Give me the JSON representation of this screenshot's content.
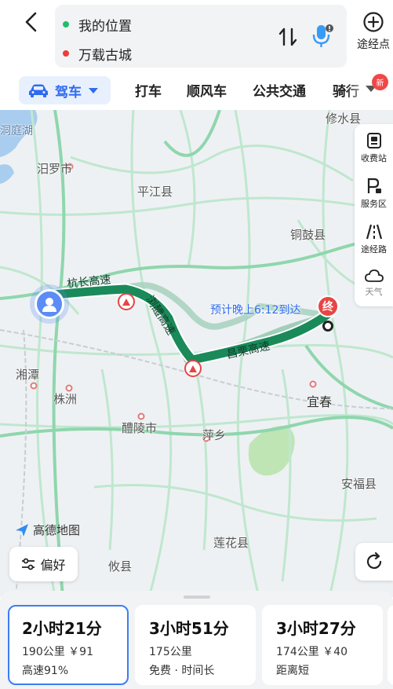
{
  "header": {
    "from": "我的位置",
    "to": "万载古城",
    "waypoint_label": "途经点"
  },
  "tabs": {
    "drive": "驾车",
    "taxi": "打车",
    "ride": "顺风车",
    "transit": "公共交通",
    "bike": "骑行",
    "new_badge": "新"
  },
  "map": {
    "places": {
      "dongting": "洞庭湖",
      "xiushui": "修水县",
      "miluo": "汨罗市",
      "pingjiang": "平江县",
      "tonggu": "铜鼓县",
      "xiangtan": "湘潭",
      "zhuzhou": "株洲",
      "yichun": "宜春",
      "liling": "醴陵市",
      "pingxiang": "萍乡",
      "anfu": "安福县",
      "lianhua": "莲花县",
      "youxian": "攸县"
    },
    "roads": {
      "hangchang": "杭长高速",
      "liuli": "浏醴高速",
      "changli": "昌栗高速"
    },
    "eta": "预计晚上6:12到达",
    "end_marker": "终",
    "brand": "高德地图",
    "preference_btn": "偏好",
    "tools": {
      "toll": "收费站",
      "service": "服务区",
      "via_road": "途经路",
      "weather": "天气"
    }
  },
  "routes": [
    {
      "time": "2小时21分",
      "meta": "190公里 ￥91",
      "tag": "高速91%"
    },
    {
      "time": "3小时51分",
      "meta": "175公里",
      "tag": "免费 · 时间长"
    },
    {
      "time": "3小时27分",
      "meta": "174公里 ￥40",
      "tag": "距离短"
    }
  ],
  "colors": {
    "accent": "#2f6bf0",
    "route": "#1a8a5a",
    "alt_route": "#93c7b0",
    "end_red": "#e84545"
  }
}
